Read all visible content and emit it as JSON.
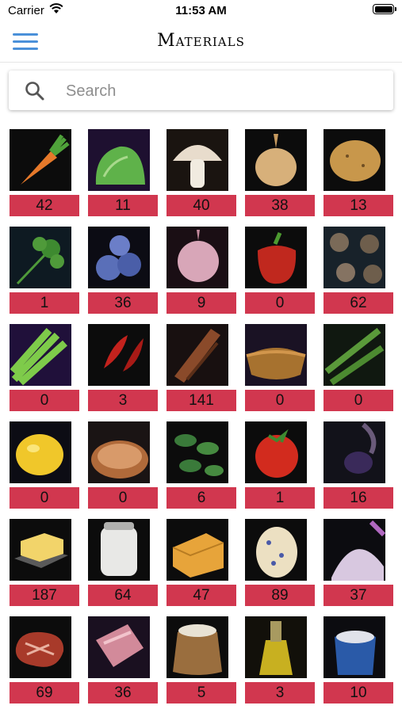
{
  "status": {
    "carrier": "Carrier",
    "time": "11:53 AM"
  },
  "header": {
    "title": "Materials"
  },
  "search": {
    "placeholder": "Search"
  },
  "materials": [
    {
      "icon": "carrot-icon",
      "count": "42"
    },
    {
      "icon": "lettuce-icon",
      "count": "11"
    },
    {
      "icon": "mushroom-icon",
      "count": "40"
    },
    {
      "icon": "onion-icon",
      "count": "38"
    },
    {
      "icon": "potato-icon",
      "count": "13"
    },
    {
      "icon": "parsley-icon",
      "count": "1"
    },
    {
      "icon": "blueberries-icon",
      "count": "36"
    },
    {
      "icon": "garlic-icon",
      "count": "9"
    },
    {
      "icon": "bell-pepper-icon",
      "count": "0"
    },
    {
      "icon": "peppercorns-icon",
      "count": "62"
    },
    {
      "icon": "celery-icon",
      "count": "0"
    },
    {
      "icon": "chili-pepper-icon",
      "count": "3"
    },
    {
      "icon": "cinnamon-icon",
      "count": "141"
    },
    {
      "icon": "spice-bowl-icon",
      "count": "0"
    },
    {
      "icon": "green-beans-icon",
      "count": "0"
    },
    {
      "icon": "lemon-icon",
      "count": "0"
    },
    {
      "icon": "seasoning-icon",
      "count": "0"
    },
    {
      "icon": "basil-icon",
      "count": "6"
    },
    {
      "icon": "tomato-icon",
      "count": "1"
    },
    {
      "icon": "blackberry-icon",
      "count": "16"
    },
    {
      "icon": "butter-icon",
      "count": "187"
    },
    {
      "icon": "milk-icon",
      "count": "64"
    },
    {
      "icon": "cheese-icon",
      "count": "47"
    },
    {
      "icon": "egg-icon",
      "count": "89"
    },
    {
      "icon": "salt-pile-icon",
      "count": "37"
    },
    {
      "icon": "steak-icon",
      "count": "69"
    },
    {
      "icon": "bacon-icon",
      "count": "36"
    },
    {
      "icon": "flour-sack-icon",
      "count": "5"
    },
    {
      "icon": "oil-bottle-icon",
      "count": "3"
    },
    {
      "icon": "salt-jar-icon",
      "count": "10"
    }
  ]
}
